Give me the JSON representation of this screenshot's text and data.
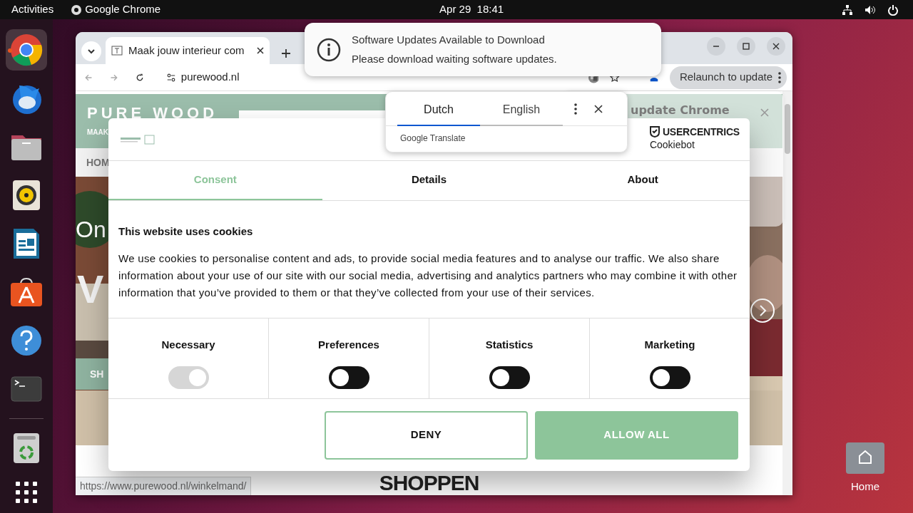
{
  "top_bar": {
    "activities": "Activities",
    "app": "Google Chrome",
    "clock": "Apr 29  18:41"
  },
  "dock": {
    "items": [
      {
        "running": true
      },
      {
        "running": false
      },
      {
        "running": false
      },
      {
        "running": false
      },
      {
        "running": false
      },
      {
        "running": false
      },
      {
        "running": false
      },
      {
        "running": false
      },
      {
        "running": false
      }
    ]
  },
  "desktop_icons": [
    {
      "label": "Home"
    }
  ],
  "browser": {
    "tabs": [
      {
        "title": "Maak jouw interieur com",
        "selected": true
      }
    ],
    "url": "purewood.nl",
    "relaunch": "Relaunch to update",
    "status_url": "https://www.purewood.nl/winkelmand/"
  },
  "page": {
    "logo": "PURE WOOD",
    "tagline": "MAAK",
    "nav": [
      "HOM"
    ],
    "hero_texts": [
      "On",
      "V"
    ],
    "hero_button": "SH",
    "heading": "SHOPPEN"
  },
  "notification": {
    "title": "Software Updates Available to Download",
    "body": "Please download waiting software updates."
  },
  "translate": {
    "languages": [
      {
        "label": "Dutch",
        "selected": true
      },
      {
        "label": "English",
        "selected": false
      }
    ],
    "brand": "Google Translate"
  },
  "update_popup": {
    "title": "update Chrome"
  },
  "cookie_dialog": {
    "brand": "USERCENTRICS",
    "product": "Cookiebot",
    "tabs": [
      {
        "label": "Consent",
        "selected": true
      },
      {
        "label": "Details",
        "selected": false
      },
      {
        "label": "About",
        "selected": false
      }
    ],
    "heading": "This website uses cookies",
    "text": "We use cookies to personalise content and ads, to provide social media features and to analyse our traffic. We also share information about your use of our site with our social media, advertising and analytics partners who may combine it with other information that you’ve provided to them or that they’ve collected from your use of their services.",
    "categories": [
      {
        "label": "Necessary",
        "on": true,
        "disabled": true
      },
      {
        "label": "Preferences",
        "on": false,
        "disabled": false
      },
      {
        "label": "Statistics",
        "on": false,
        "disabled": false
      },
      {
        "label": "Marketing",
        "on": false,
        "disabled": false
      }
    ],
    "buttons": [
      {
        "label": "DENY",
        "kind": "outline"
      },
      {
        "label": "ALLOW ALL",
        "kind": "filled"
      }
    ]
  }
}
